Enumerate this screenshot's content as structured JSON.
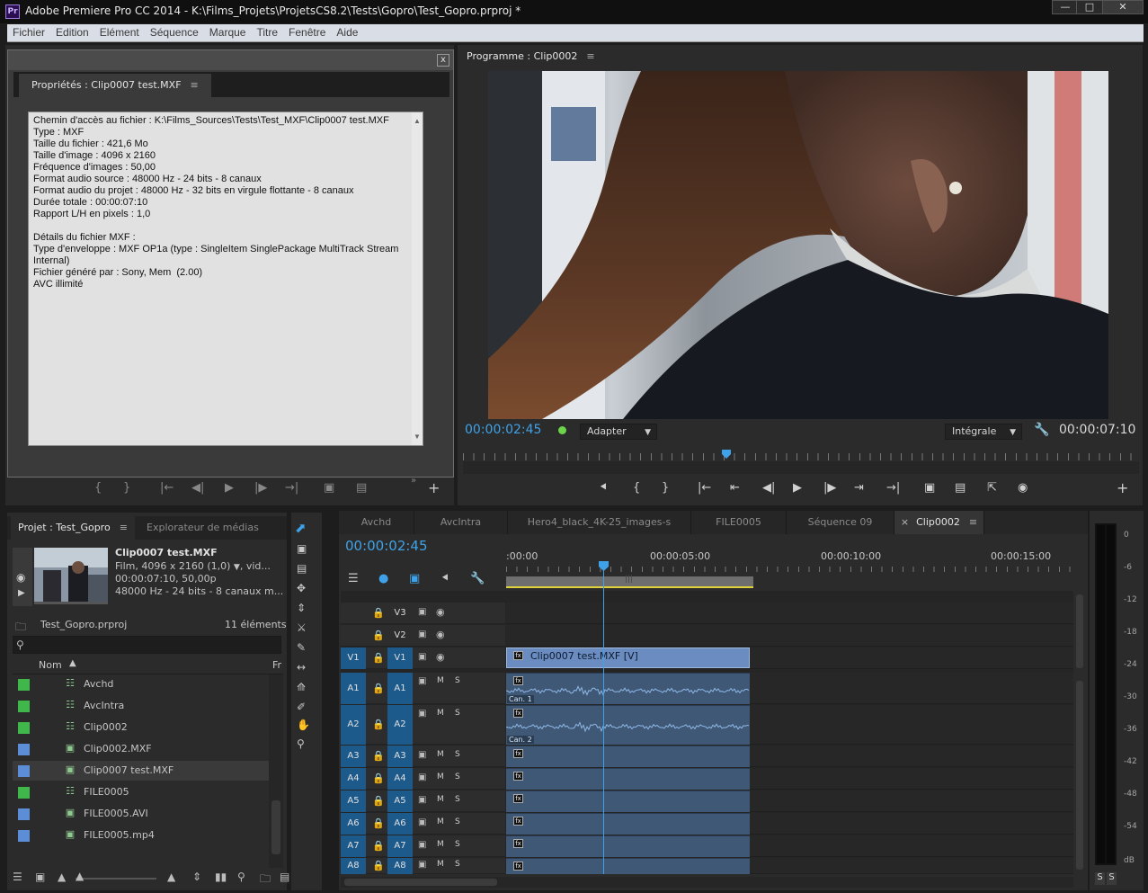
{
  "app": {
    "title": "Adobe Premiere Pro CC 2014 - K:\\Films_Projets\\ProjetsCS8.2\\Tests\\Gopro\\Test_Gopro.prproj *",
    "logo": "Pr"
  },
  "menu": [
    "Fichier",
    "Edition",
    "Elément",
    "Séquence",
    "Marque",
    "Titre",
    "Fenêtre",
    "Aide"
  ],
  "properties": {
    "tab_label": "Propriétés : Clip0007 test.MXF",
    "lines": [
      "Chemin d'accès au fichier : K:\\Films_Sources\\Tests\\Test_MXF\\Clip0007 test.MXF",
      "Type : MXF",
      "Taille du fichier : 421,6 Mo",
      "Taille d'image : 4096 x 2160",
      "Fréquence d'images : 50,00",
      "Format audio source : 48000 Hz - 24 bits - 8 canaux",
      "Format audio du projet : 48000 Hz - 32 bits en virgule flottante - 8 canaux",
      "Durée totale : 00:00:07:10",
      "Rapport L/H en pixels : 1,0",
      "",
      "Détails du fichier MXF :",
      "Type d'enveloppe : MXF OP1a (type : SingleItem SinglePackage MultiTrack Stream",
      "Internal)",
      "Fichier généré par : Sony, Mem  (2.00)",
      "AVC illimité"
    ]
  },
  "program": {
    "tab_label": "Programme : Clip0002",
    "timecode": "00:00:02:45",
    "fit_label": "Adapter",
    "quality_label": "Intégrale",
    "duration": "00:00:07:10",
    "playhead_fraction": 0.39
  },
  "project": {
    "tab_label": "Projet : Test_Gopro",
    "media_browser_tab": "Explorateur de médias",
    "clip_name": "Clip0007 test.MXF",
    "clip_line1": "Film, 4096 x 2160 (1,0)",
    "clip_line1_suffix": ", vid...",
    "clip_line2": "00:00:07:10, 50,00p",
    "clip_line3": "48000 Hz - 24 bits - 8 canaux m...",
    "project_file": "Test_Gopro.prproj",
    "item_count": "11 éléments",
    "col_name": "Nom",
    "col_fr": "Fr",
    "items": [
      {
        "name": "Avchd",
        "color": "#3fb74a",
        "icon": "sequence-icon"
      },
      {
        "name": "AvcIntra",
        "color": "#3fb74a",
        "icon": "sequence-icon"
      },
      {
        "name": "Clip0002",
        "color": "#3fb74a",
        "icon": "sequence-icon"
      },
      {
        "name": "Clip0002.MXF",
        "color": "#5b8ed6",
        "icon": "clip-icon"
      },
      {
        "name": "Clip0007 test.MXF",
        "color": "#5b8ed6",
        "icon": "clip-icon"
      },
      {
        "name": "FILE0005",
        "color": "#3fb74a",
        "icon": "sequence-icon"
      },
      {
        "name": "FILE0005.AVI",
        "color": "#5b8ed6",
        "icon": "clip-icon"
      },
      {
        "name": "FILE0005.mp4",
        "color": "#5b8ed6",
        "icon": "clip-icon"
      }
    ]
  },
  "timeline": {
    "tabs": [
      "Avchd",
      "AvcIntra",
      "Hero4_black_4K-25_images-s",
      "FILE0005",
      "Séquence 09",
      "Clip0002"
    ],
    "active_tab": "Clip0002",
    "timecode": "00:00:02:45",
    "ruler": [
      ":00:00",
      "00:00:05:00",
      "00:00:10:00",
      "00:00:15:00"
    ],
    "video_tracks": [
      {
        "name": "V3",
        "target": ""
      },
      {
        "name": "V2",
        "target": ""
      },
      {
        "name": "V1",
        "target": "V1"
      }
    ],
    "audio_tracks": [
      {
        "name": "A1",
        "target": "A1"
      },
      {
        "name": "A2",
        "target": "A2"
      },
      {
        "name": "A3",
        "target": "A3"
      },
      {
        "name": "A4",
        "target": "A4"
      },
      {
        "name": "A5",
        "target": "A5"
      },
      {
        "name": "A6",
        "target": "A6"
      },
      {
        "name": "A7",
        "target": "A7"
      },
      {
        "name": "A8",
        "target": "A8"
      }
    ],
    "video_clip_label": "Clip0007 test.MXF [V]",
    "audio_labels": [
      "Can. 1",
      "Can. 2"
    ],
    "m_label": "M",
    "s_label": "S"
  },
  "meter": {
    "scale": [
      "0",
      "-6",
      "-12",
      "-18",
      "-24",
      "-30",
      "-36",
      "-42",
      "-48",
      "-54",
      "dB"
    ],
    "solo_labels": [
      "S",
      "S"
    ]
  },
  "colors": {
    "accent_blue": "#3fa2e8",
    "track_target": "#1d5a8c",
    "clip_blue": "#3f5876",
    "video_clip": "#6b8cc0"
  }
}
